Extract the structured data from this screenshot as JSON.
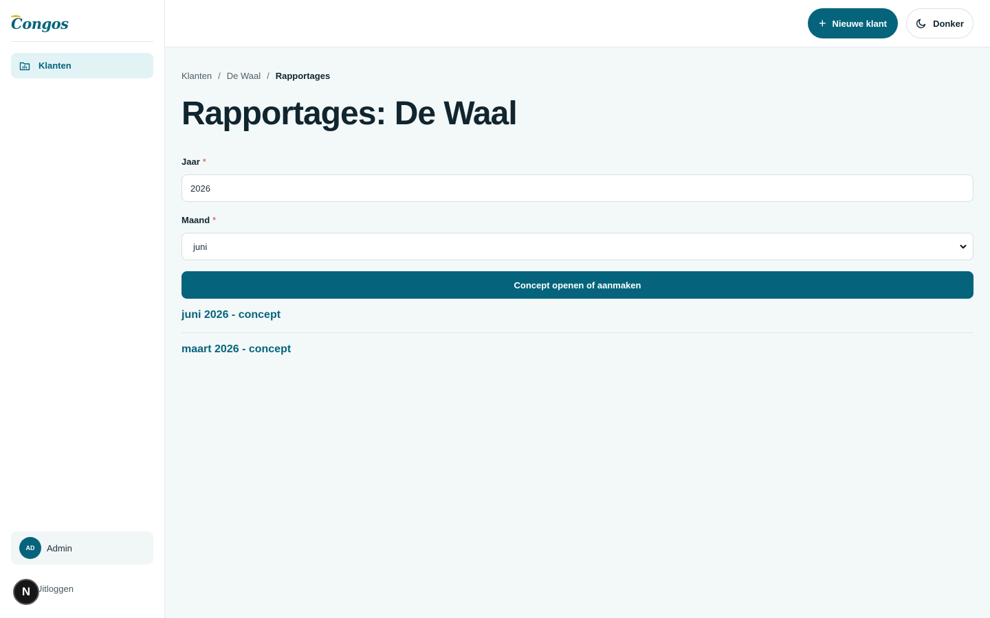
{
  "app": {
    "logo_text": "Congos"
  },
  "sidebar": {
    "items": [
      {
        "label": "Klanten",
        "icon": "folder-chart-icon",
        "active": true
      }
    ],
    "user": {
      "initials": "AD",
      "name": "Admin"
    },
    "logout_label": "Uitloggen"
  },
  "topbar": {
    "new_client_label": "Nieuwe klant",
    "theme_toggle_label": "Donker"
  },
  "breadcrumb": {
    "items": [
      "Klanten",
      "De Waal",
      "Rapportages"
    ],
    "separator": "/"
  },
  "page": {
    "title": "Rapportages: De Waal"
  },
  "form": {
    "year": {
      "label": "Jaar",
      "required_marker": "*",
      "value": "2026"
    },
    "month": {
      "label": "Maand",
      "required_marker": "*",
      "value": "juni"
    },
    "submit_label": "Concept openen of aanmaken"
  },
  "reports": [
    {
      "label": "juni 2026 - concept"
    },
    {
      "label": "maart 2026 - concept"
    }
  ],
  "colors": {
    "brand": "#05647c",
    "accent": "#e8b931",
    "required": "#d23b3b",
    "background": "#f3f8f9"
  }
}
